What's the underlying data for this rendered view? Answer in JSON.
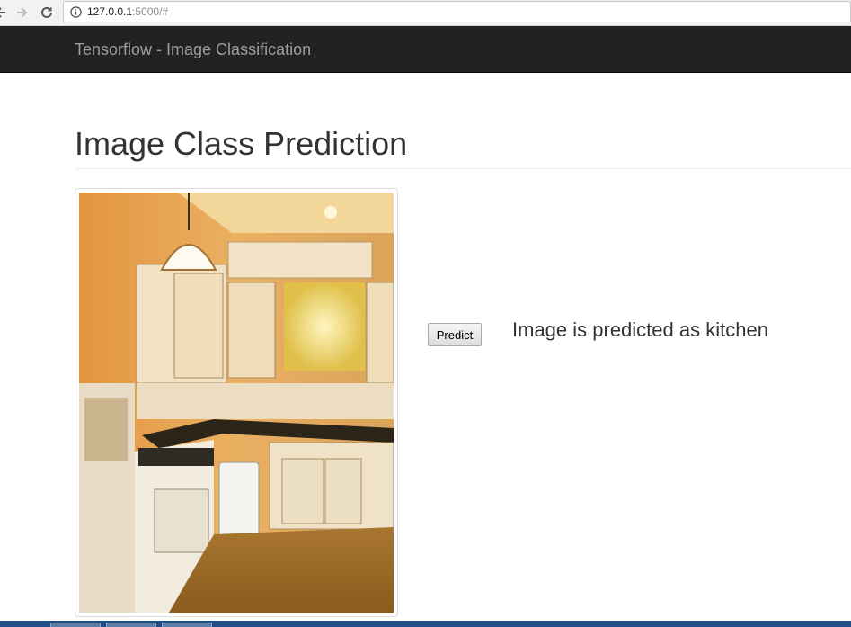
{
  "browser": {
    "url_host": "127.0.0.1",
    "url_rest": ":5000/#"
  },
  "navbar": {
    "brand": "Tensorflow - Image Classification"
  },
  "main": {
    "title": "Image Class Prediction",
    "predict_label": "Predict",
    "result_text": "Image is predicted as kitchen"
  },
  "colors": {
    "navbar_bg": "#222222",
    "brand_text": "#9d9d9d",
    "taskbar": "#1f4f86"
  },
  "icons": [
    "back-arrow-icon",
    "forward-arrow-icon",
    "reload-icon",
    "info-icon"
  ]
}
